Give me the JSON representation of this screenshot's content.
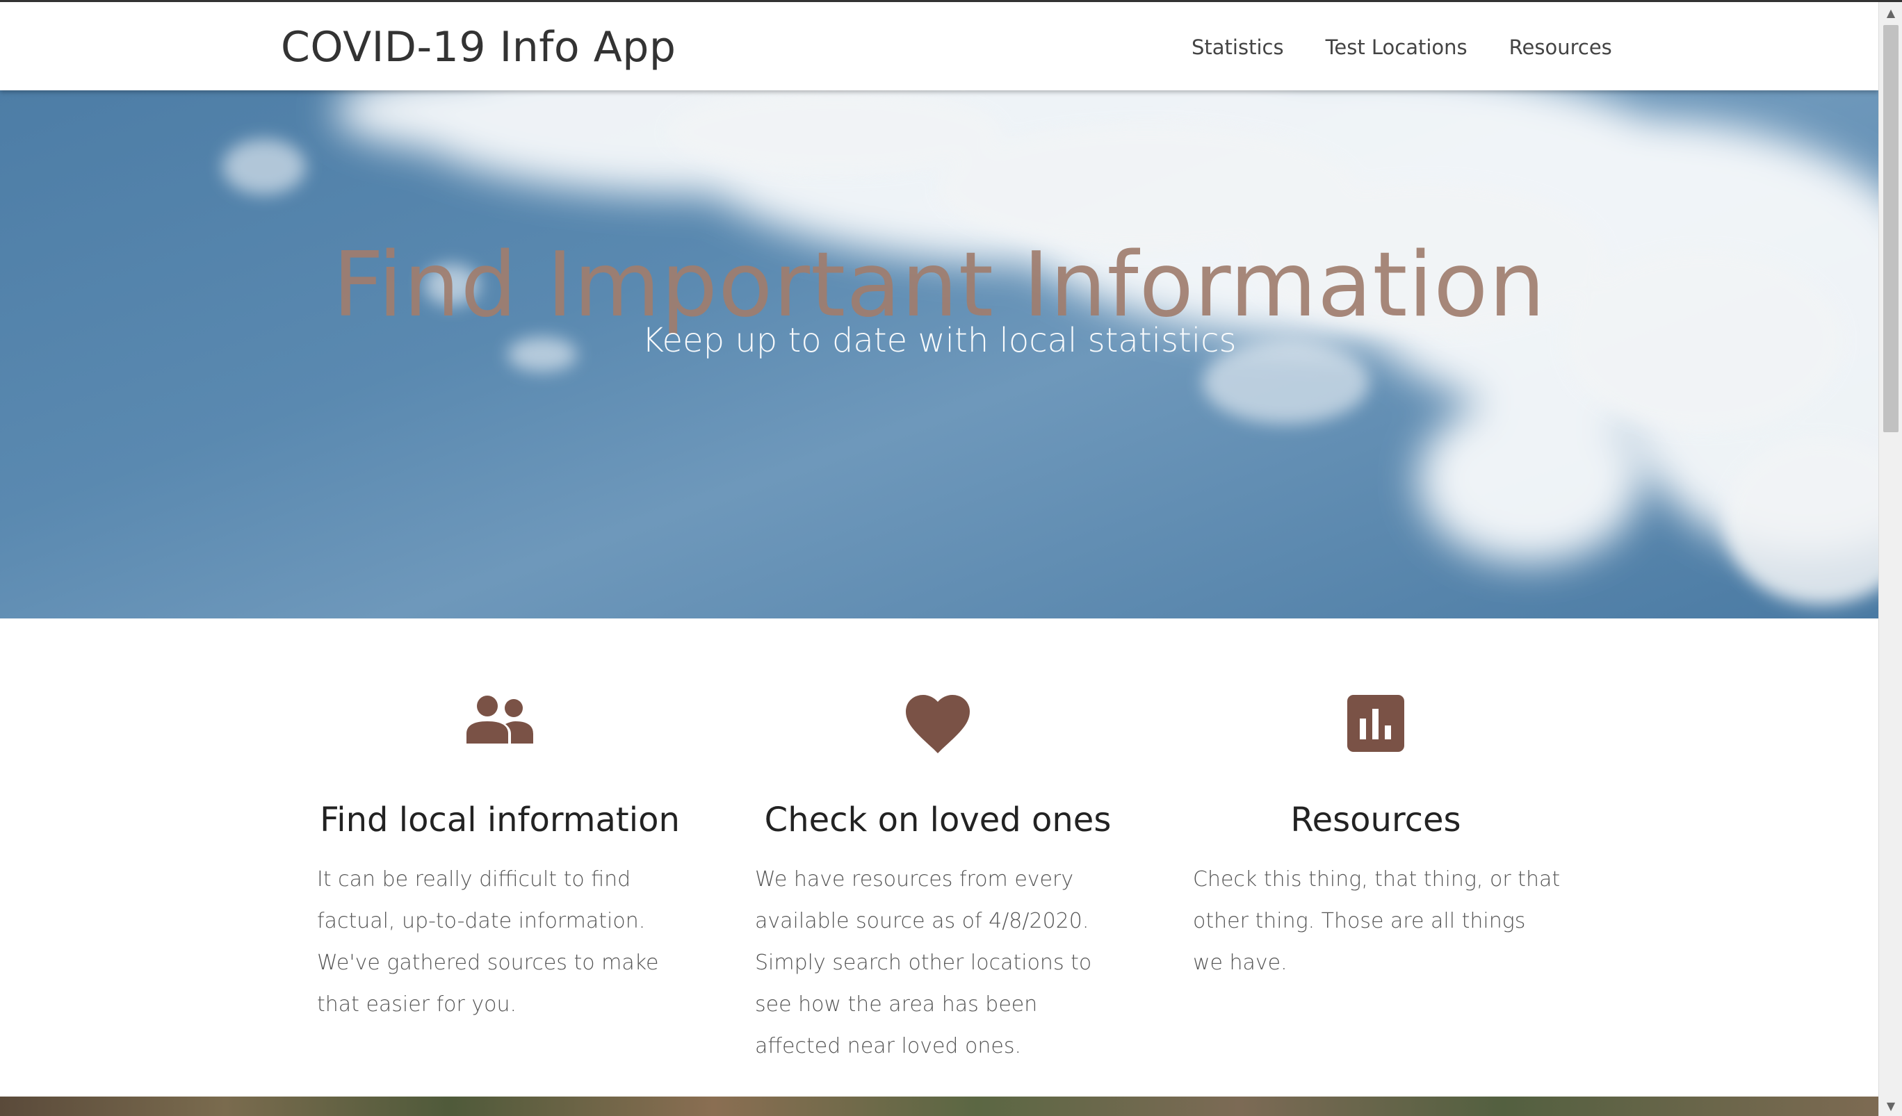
{
  "navbar": {
    "brand": "COVID-19 Info App",
    "links": [
      "Statistics",
      "Test Locations",
      "Resources"
    ]
  },
  "hero": {
    "title": "Find Important Information",
    "subtitle": "Keep up to date with local statistics"
  },
  "features": [
    {
      "icon": "people-icon",
      "title": "Find local information",
      "text": "It can be really difficult to find factual, up-to-date information. We've gathered sources to make that easier for you."
    },
    {
      "icon": "heart-icon",
      "title": "Check on loved ones",
      "text": "We have resources from every available source as of 4/8/2020. Simply search other locations to see how the area has been affected near loved ones."
    },
    {
      "icon": "bar-chart-icon",
      "title": "Resources",
      "text": "Check this thing, that thing, or that other thing. Those are all things we have."
    }
  ],
  "colors": {
    "accent": "#7a5246",
    "hero_title": "#a07d6e",
    "sky": "#4d7da6"
  }
}
